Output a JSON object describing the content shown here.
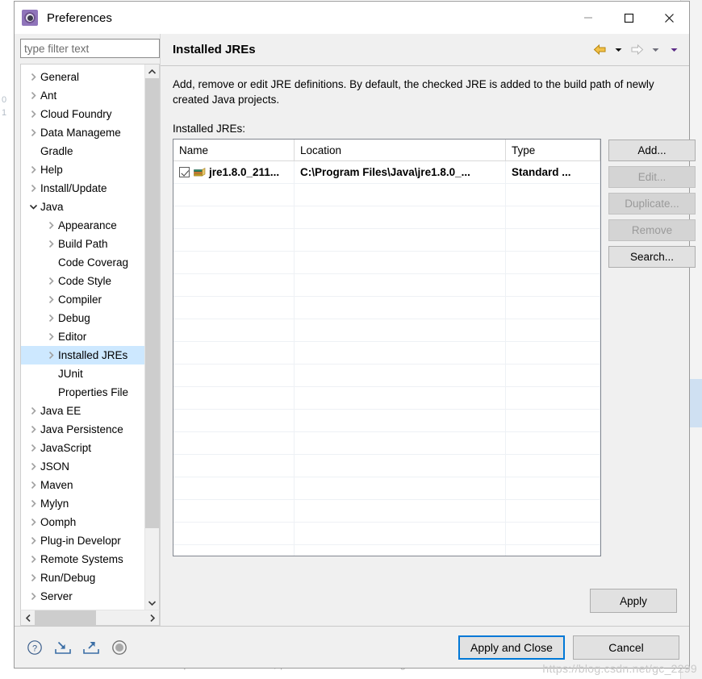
{
  "window": {
    "title": "Preferences",
    "icon": "preferences-gear-icon",
    "minimize_label": "—",
    "maximize_label": "□",
    "close_label": "✕"
  },
  "sidebar": {
    "filter": {
      "placeholder": "type filter text",
      "value": ""
    },
    "items": [
      {
        "label": "General",
        "indent": 0,
        "expandable": true,
        "expanded": false,
        "selected": false
      },
      {
        "label": "Ant",
        "indent": 0,
        "expandable": true,
        "expanded": false,
        "selected": false
      },
      {
        "label": "Cloud Foundry",
        "indent": 0,
        "expandable": true,
        "expanded": false,
        "selected": false
      },
      {
        "label": "Data Manageme",
        "indent": 0,
        "expandable": true,
        "expanded": false,
        "selected": false
      },
      {
        "label": "Gradle",
        "indent": 0,
        "expandable": false,
        "expanded": false,
        "selected": false
      },
      {
        "label": "Help",
        "indent": 0,
        "expandable": true,
        "expanded": false,
        "selected": false
      },
      {
        "label": "Install/Update",
        "indent": 0,
        "expandable": true,
        "expanded": false,
        "selected": false
      },
      {
        "label": "Java",
        "indent": 0,
        "expandable": true,
        "expanded": true,
        "selected": false
      },
      {
        "label": "Appearance",
        "indent": 1,
        "expandable": true,
        "expanded": false,
        "selected": false
      },
      {
        "label": "Build Path",
        "indent": 1,
        "expandable": true,
        "expanded": false,
        "selected": false
      },
      {
        "label": "Code Coverag",
        "indent": 1,
        "expandable": false,
        "expanded": false,
        "selected": false
      },
      {
        "label": "Code Style",
        "indent": 1,
        "expandable": true,
        "expanded": false,
        "selected": false
      },
      {
        "label": "Compiler",
        "indent": 1,
        "expandable": true,
        "expanded": false,
        "selected": false
      },
      {
        "label": "Debug",
        "indent": 1,
        "expandable": true,
        "expanded": false,
        "selected": false
      },
      {
        "label": "Editor",
        "indent": 1,
        "expandable": true,
        "expanded": false,
        "selected": false
      },
      {
        "label": "Installed JREs",
        "indent": 1,
        "expandable": true,
        "expanded": false,
        "selected": true
      },
      {
        "label": "JUnit",
        "indent": 1,
        "expandable": false,
        "expanded": false,
        "selected": false
      },
      {
        "label": "Properties File",
        "indent": 1,
        "expandable": false,
        "expanded": false,
        "selected": false
      },
      {
        "label": "Java EE",
        "indent": 0,
        "expandable": true,
        "expanded": false,
        "selected": false
      },
      {
        "label": "Java Persistence",
        "indent": 0,
        "expandable": true,
        "expanded": false,
        "selected": false
      },
      {
        "label": "JavaScript",
        "indent": 0,
        "expandable": true,
        "expanded": false,
        "selected": false
      },
      {
        "label": "JSON",
        "indent": 0,
        "expandable": true,
        "expanded": false,
        "selected": false
      },
      {
        "label": "Maven",
        "indent": 0,
        "expandable": true,
        "expanded": false,
        "selected": false
      },
      {
        "label": "Mylyn",
        "indent": 0,
        "expandable": true,
        "expanded": false,
        "selected": false
      },
      {
        "label": "Oomph",
        "indent": 0,
        "expandable": true,
        "expanded": false,
        "selected": false
      },
      {
        "label": "Plug-in Developr",
        "indent": 0,
        "expandable": true,
        "expanded": false,
        "selected": false
      },
      {
        "label": "Remote Systems",
        "indent": 0,
        "expandable": true,
        "expanded": false,
        "selected": false
      },
      {
        "label": "Run/Debug",
        "indent": 0,
        "expandable": true,
        "expanded": false,
        "selected": false
      },
      {
        "label": "Server",
        "indent": 0,
        "expandable": true,
        "expanded": false,
        "selected": false
      }
    ]
  },
  "page": {
    "title": "Installed JREs",
    "description": "Add, remove or edit JRE definitions. By default, the checked JRE is added to the build path of newly created Java projects.",
    "list_label": "Installed JREs:",
    "nav": {
      "back_icon": "back-arrow-icon",
      "back_menu_icon": "chevron-down-icon",
      "forward_icon": "forward-arrow-icon",
      "forward_menu_icon": "chevron-down-icon",
      "more_menu_icon": "chevron-down-icon"
    },
    "table": {
      "columns": [
        "Name",
        "Location",
        "Type"
      ],
      "rows": [
        {
          "checked": true,
          "icon": "jre-icon",
          "name": "jre1.8.0_211...",
          "location": "C:\\Program Files\\Java\\jre1.8.0_...",
          "type": "Standard ..."
        }
      ],
      "empty_row_count": 17
    },
    "side_buttons": [
      {
        "label": "Add...",
        "enabled": true
      },
      {
        "label": "Edit...",
        "enabled": false
      },
      {
        "label": "Duplicate...",
        "enabled": false
      },
      {
        "label": "Remove",
        "enabled": false
      },
      {
        "label": "Search...",
        "enabled": true
      }
    ],
    "apply_label": "Apply"
  },
  "footer": {
    "icons": [
      {
        "name": "help-icon",
        "label": "?"
      },
      {
        "name": "import-icon",
        "label": ""
      },
      {
        "name": "export-icon",
        "label": ""
      },
      {
        "name": "status-icon",
        "label": ""
      }
    ],
    "apply_and_close_label": "Apply and Close",
    "cancel_label": "Cancel"
  },
  "watermark": "https://blog.csdn.net/gc_2299",
  "colors": {
    "selection": "#cde8ff",
    "focus_border": "#0078d7",
    "back_arrow": "#e0a82e",
    "dialog_bg": "#f0f0f0"
  }
}
